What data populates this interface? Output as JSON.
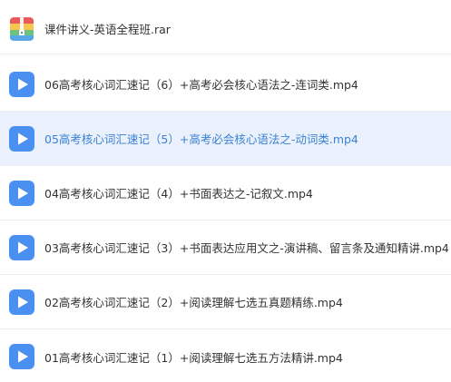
{
  "files": [
    {
      "name": "课件讲义-英语全程班.rar",
      "icon": "archive-icon",
      "selected": false
    },
    {
      "name": "06高考核心词汇速记（6）+高考必会核心语法之-连词类.mp4",
      "icon": "video-play-icon",
      "selected": false
    },
    {
      "name": "05高考核心词汇速记（5）+高考必会核心语法之-动词类.mp4",
      "icon": "video-play-icon",
      "selected": true
    },
    {
      "name": "04高考核心词汇速记（4）+书面表达之-记叙文.mp4",
      "icon": "video-play-icon",
      "selected": false
    },
    {
      "name": "03高考核心词汇速记（3）+书面表达应用文之-演讲稿、留言条及通知精讲.mp4",
      "icon": "video-play-icon",
      "selected": false
    },
    {
      "name": "02高考核心词汇速记（2）+阅读理解七选五真题精练.mp4",
      "icon": "video-play-icon",
      "selected": false
    },
    {
      "name": "01高考核心词汇速记（1）+阅读理解七选五方法精讲.mp4",
      "icon": "video-play-icon",
      "selected": false
    }
  ],
  "colors": {
    "selected_bg": "#eaf1fc",
    "selected_text": "#3b82d6",
    "text": "#333333",
    "video_icon": "#4a90f0"
  }
}
